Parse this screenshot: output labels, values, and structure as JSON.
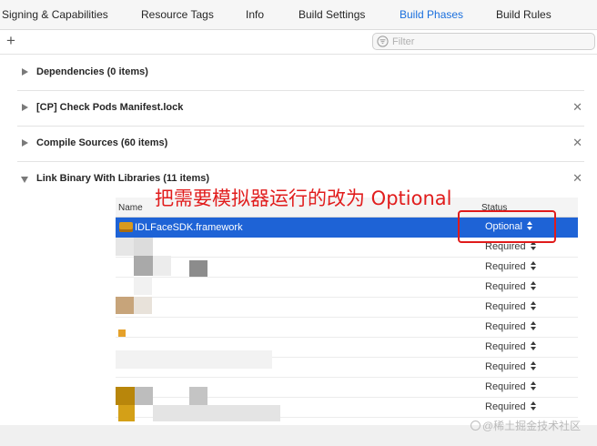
{
  "tabs": [
    {
      "label": "Signing & Capabilities",
      "active": false
    },
    {
      "label": "Resource Tags",
      "active": false
    },
    {
      "label": "Info",
      "active": false
    },
    {
      "label": "Build Settings",
      "active": false
    },
    {
      "label": "Build Phases",
      "active": true
    },
    {
      "label": "Build Rules",
      "active": false
    }
  ],
  "accent_color": "#1a6fdd",
  "toolbar": {
    "add_icon": "plus-icon",
    "filter_placeholder": "Filter",
    "filter_icon": "filter-icon"
  },
  "phases": [
    {
      "title": "Dependencies (0 items)",
      "expanded": false,
      "closable": false
    },
    {
      "title": "[CP] Check Pods Manifest.lock",
      "expanded": false,
      "closable": true
    },
    {
      "title": "Compile Sources (60 items)",
      "expanded": false,
      "closable": true
    },
    {
      "title": "Link Binary With Libraries (11 items)",
      "expanded": true,
      "closable": true
    }
  ],
  "link_table": {
    "headers": {
      "name": "Name",
      "status": "Status"
    },
    "rows": [
      {
        "name": "IDLFaceSDK.framework",
        "status": "Optional",
        "selected": true
      },
      {
        "name": "",
        "status": "Required"
      },
      {
        "name": "",
        "status": "Required"
      },
      {
        "name": "",
        "status": "Required"
      },
      {
        "name": "",
        "status": "Required"
      },
      {
        "name": "",
        "status": "Required"
      },
      {
        "name": "",
        "status": "Required"
      },
      {
        "name": "",
        "status": "Required"
      },
      {
        "name": "",
        "status": "Required"
      },
      {
        "name": "",
        "status": "Required"
      }
    ]
  },
  "annotation": {
    "text": "把需要模拟器运行的改为 Optional",
    "color": "#e11d1d"
  },
  "watermark": "@稀土掘金技术社区",
  "selection_color": "#1e63d6"
}
